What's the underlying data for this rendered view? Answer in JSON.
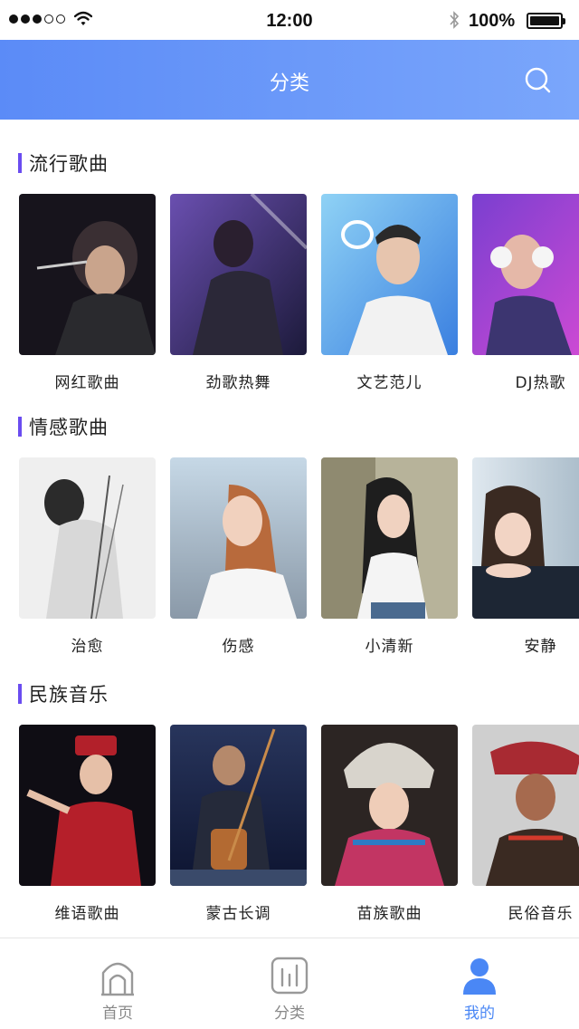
{
  "status_bar": {
    "time": "12:00",
    "battery": "100%"
  },
  "header": {
    "title": "分类"
  },
  "sections": [
    {
      "title": "流行歌曲",
      "items": [
        "网红歌曲",
        "劲歌热舞",
        "文艺范儿",
        "DJ热歌"
      ]
    },
    {
      "title": "情感歌曲",
      "items": [
        "治愈",
        "伤感",
        "小清新",
        "安静"
      ]
    },
    {
      "title": "民族音乐",
      "items": [
        "维语歌曲",
        "蒙古长调",
        "苗族歌曲",
        "民俗音乐"
      ]
    }
  ],
  "tabbar": {
    "tabs": [
      {
        "label": "首页"
      },
      {
        "label": "分类"
      },
      {
        "label": "我的"
      }
    ],
    "active": 2
  },
  "colors": {
    "header_start": "#5b8bf7",
    "header_end": "#7aa6fb",
    "accent": "#6a4cf0",
    "tab_active": "#4a87f5"
  }
}
